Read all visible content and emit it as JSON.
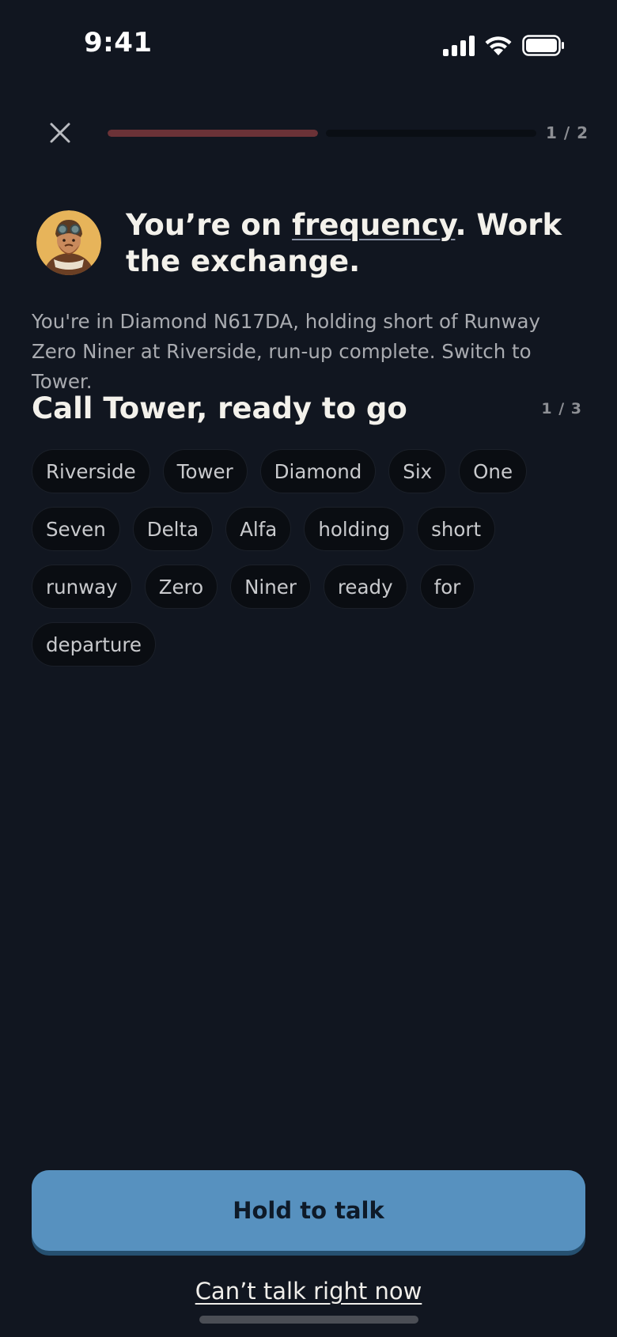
{
  "status_bar": {
    "time": "9:41",
    "icons": [
      "cellular-signal-icon",
      "wifi-icon",
      "battery-icon"
    ]
  },
  "progress": {
    "counter": "1 / 2",
    "current_step": 1,
    "total_steps": 2,
    "step1_fill_fraction": 1.0,
    "step2_fill_fraction": 0.0,
    "fill_color": "#6b3237"
  },
  "header": {
    "title_before": "You’re on ",
    "title_link": "frequency",
    "title_after": ". Work the exchange.",
    "avatar_icon": "aviator-avatar-icon"
  },
  "scenario_text": "You're in Diamond N617DA, holding short of Runway Zero Niner at Riverside, run-up complete. Switch to Tower.",
  "task": {
    "title": "Call Tower, ready to go",
    "counter": "1 / 3"
  },
  "word_chips": [
    "Riverside",
    "Tower",
    "Diamond",
    "Six",
    "One",
    "Seven",
    "Delta",
    "Alfa",
    "holding",
    "short",
    "runway",
    "Zero",
    "Niner",
    "ready",
    "for",
    "departure"
  ],
  "actions": {
    "hold_to_talk": "Hold to talk",
    "cant_talk": "Can’t talk right now"
  },
  "colors": {
    "background": "#111620",
    "accent_button": "#5791bf",
    "accent_button_shadow": "#265070",
    "chip_background": "#0a0d12"
  }
}
